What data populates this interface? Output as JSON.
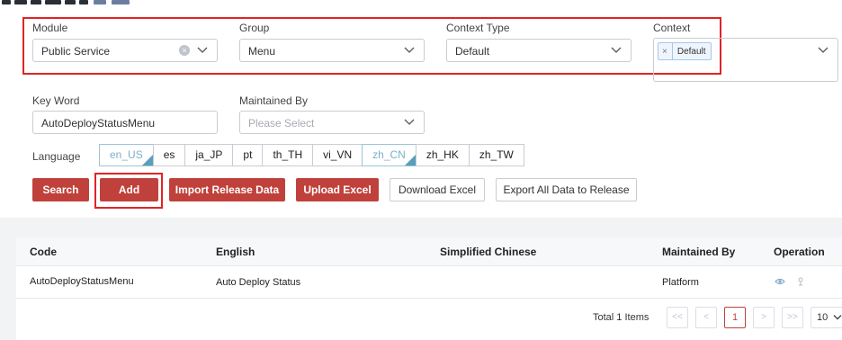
{
  "filters": {
    "module": {
      "label": "Module",
      "value": "Public Service"
    },
    "group": {
      "label": "Group",
      "value": "Menu"
    },
    "context_type": {
      "label": "Context Type",
      "value": "Default"
    },
    "context": {
      "label": "Context",
      "tag": "Default",
      "tag_close": "×"
    },
    "keyword": {
      "label": "Key Word",
      "value": "AutoDeployStatusMenu"
    },
    "maintained_by": {
      "label": "Maintained By",
      "placeholder": "Please Select"
    }
  },
  "language": {
    "label": "Language",
    "options": [
      {
        "code": "en_US",
        "active": true
      },
      {
        "code": "es",
        "active": false
      },
      {
        "code": "ja_JP",
        "active": false
      },
      {
        "code": "pt",
        "active": false
      },
      {
        "code": "th_TH",
        "active": false
      },
      {
        "code": "vi_VN",
        "active": false
      },
      {
        "code": "zh_CN",
        "active": true
      },
      {
        "code": "zh_HK",
        "active": false
      },
      {
        "code": "zh_TW",
        "active": false
      }
    ]
  },
  "actions": {
    "search": "Search",
    "add": "Add",
    "import_release": "Import Release Data",
    "upload_excel": "Upload Excel",
    "download_excel": "Download Excel",
    "export_all": "Export All Data to Release"
  },
  "table": {
    "headers": {
      "code": "Code",
      "english": "English",
      "simplified_chinese": "Simplified Chinese",
      "maintained_by": "Maintained By",
      "operation": "Operation"
    },
    "rows": [
      {
        "code": "AutoDeployStatusMenu",
        "english": "Auto Deploy Status",
        "simplified_chinese": "",
        "maintained_by": "Platform"
      }
    ]
  },
  "pagination": {
    "total_text": "Total 1 Items",
    "first": "<<",
    "prev": "<",
    "current_page": "1",
    "next": ">",
    "last": ">>",
    "page_size": "10"
  },
  "colors": {
    "accent_red": "#c0413b",
    "annotation_red": "#e02424",
    "active_lang": "#5a9dbc"
  }
}
